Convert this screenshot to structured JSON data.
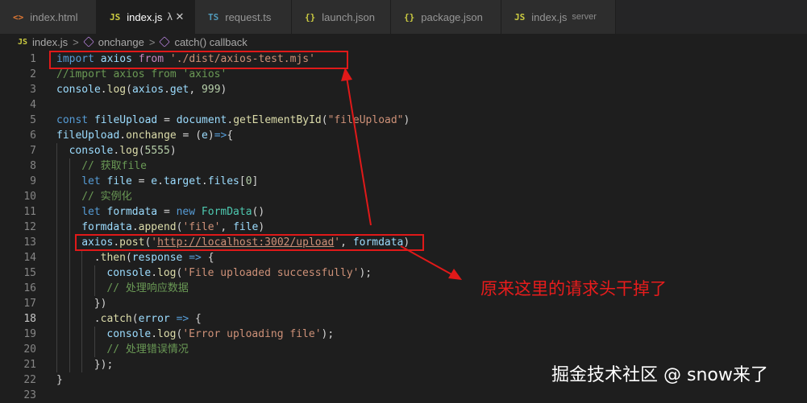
{
  "tabs": [
    {
      "icon": "<>",
      "icon_class": "ico-html",
      "label": "index.html",
      "desc": "",
      "mark": "",
      "active": false,
      "width": 120
    },
    {
      "icon": "JS",
      "icon_class": "ico-js",
      "label": "index.js",
      "desc": "",
      "mark": "λ ✕",
      "active": true,
      "width": 122
    },
    {
      "icon": "TS",
      "icon_class": "ico-ts",
      "label": "request.ts",
      "desc": "",
      "mark": "",
      "active": false,
      "width": 120
    },
    {
      "icon": "{}",
      "icon_class": "ico-json",
      "label": "launch.json",
      "desc": "",
      "mark": "",
      "active": false,
      "width": 123
    },
    {
      "icon": "{}",
      "icon_class": "ico-json",
      "label": "package.json",
      "desc": "",
      "mark": "",
      "active": false,
      "width": 137
    },
    {
      "icon": "JS",
      "icon_class": "ico-js",
      "label": "index.js",
      "desc": "server",
      "mark": "",
      "active": false,
      "width": 142
    }
  ],
  "breadcrumb": {
    "file": "index.js",
    "sep": ">",
    "item1": "onchange",
    "item2": "catch() callback",
    "file_icon": "JS"
  },
  "lines": [
    {
      "n": "1",
      "indent": 0,
      "tokens": [
        [
          "kw",
          "import"
        ],
        [
          "pn",
          " "
        ],
        [
          "var",
          "axios"
        ],
        [
          "pn",
          " "
        ],
        [
          "ctl",
          "from"
        ],
        [
          "pn",
          " "
        ],
        [
          "str",
          "'./dist/axios-test.mjs'"
        ]
      ]
    },
    {
      "n": "2",
      "indent": 0,
      "tokens": [
        [
          "cmt",
          "//import axios from 'axios'"
        ]
      ]
    },
    {
      "n": "3",
      "indent": 0,
      "tokens": [
        [
          "var",
          "console"
        ],
        [
          "pn",
          "."
        ],
        [
          "fn",
          "log"
        ],
        [
          "pn",
          "("
        ],
        [
          "var",
          "axios"
        ],
        [
          "pn",
          "."
        ],
        [
          "var",
          "get"
        ],
        [
          "pn",
          ", "
        ],
        [
          "num",
          "999"
        ],
        [
          "pn",
          ")"
        ]
      ]
    },
    {
      "n": "4",
      "indent": 0,
      "tokens": []
    },
    {
      "n": "5",
      "indent": 0,
      "tokens": [
        [
          "kw",
          "const"
        ],
        [
          "pn",
          " "
        ],
        [
          "var",
          "fileUpload"
        ],
        [
          "pn",
          " = "
        ],
        [
          "var",
          "document"
        ],
        [
          "pn",
          "."
        ],
        [
          "fn",
          "getElementById"
        ],
        [
          "pn",
          "("
        ],
        [
          "str",
          "\"fileUpload\""
        ],
        [
          "pn",
          ")"
        ]
      ]
    },
    {
      "n": "6",
      "indent": 0,
      "tokens": [
        [
          "var",
          "fileUpload"
        ],
        [
          "pn",
          "."
        ],
        [
          "fn",
          "onchange"
        ],
        [
          "pn",
          " = ("
        ],
        [
          "var",
          "e"
        ],
        [
          "pn",
          ")"
        ],
        [
          "kw",
          "=>"
        ],
        [
          "pn",
          "{"
        ]
      ]
    },
    {
      "n": "7",
      "indent": 1,
      "tokens": [
        [
          "var",
          "console"
        ],
        [
          "pn",
          "."
        ],
        [
          "fn",
          "log"
        ],
        [
          "pn",
          "("
        ],
        [
          "num",
          "5555"
        ],
        [
          "pn",
          ")"
        ]
      ]
    },
    {
      "n": "8",
      "indent": 2,
      "tokens": [
        [
          "cmt",
          "// 获取file"
        ]
      ]
    },
    {
      "n": "9",
      "indent": 2,
      "tokens": [
        [
          "kw",
          "let"
        ],
        [
          "pn",
          " "
        ],
        [
          "var",
          "file"
        ],
        [
          "pn",
          " = "
        ],
        [
          "var",
          "e"
        ],
        [
          "pn",
          "."
        ],
        [
          "var",
          "target"
        ],
        [
          "pn",
          "."
        ],
        [
          "var",
          "files"
        ],
        [
          "pn",
          "["
        ],
        [
          "num",
          "0"
        ],
        [
          "pn",
          "]"
        ]
      ]
    },
    {
      "n": "10",
      "indent": 2,
      "tokens": [
        [
          "cmt",
          "// 实例化"
        ]
      ]
    },
    {
      "n": "11",
      "indent": 2,
      "tokens": [
        [
          "kw",
          "let"
        ],
        [
          "pn",
          " "
        ],
        [
          "var",
          "formdata"
        ],
        [
          "pn",
          " = "
        ],
        [
          "kw",
          "new"
        ],
        [
          "pn",
          " "
        ],
        [
          "cls",
          "FormData"
        ],
        [
          "pn",
          "()"
        ]
      ]
    },
    {
      "n": "12",
      "indent": 2,
      "tokens": [
        [
          "var",
          "formdata"
        ],
        [
          "pn",
          "."
        ],
        [
          "fn",
          "append"
        ],
        [
          "pn",
          "("
        ],
        [
          "str",
          "'file'"
        ],
        [
          "pn",
          ", "
        ],
        [
          "var",
          "file"
        ],
        [
          "pn",
          ")"
        ]
      ]
    },
    {
      "n": "13",
      "indent": 2,
      "tokens": [
        [
          "var",
          "axios"
        ],
        [
          "pn",
          "."
        ],
        [
          "fn",
          "post"
        ],
        [
          "pn",
          "("
        ],
        [
          "str",
          "'"
        ],
        [
          "url",
          "http://localhost:3002/upload"
        ],
        [
          "str",
          "'"
        ],
        [
          "pn",
          ", "
        ],
        [
          "var",
          "formdata"
        ],
        [
          "pn",
          ")"
        ]
      ]
    },
    {
      "n": "14",
      "indent": 3,
      "tokens": [
        [
          "pn",
          "."
        ],
        [
          "fn",
          "then"
        ],
        [
          "pn",
          "("
        ],
        [
          "var",
          "response"
        ],
        [
          "pn",
          " "
        ],
        [
          "kw",
          "=>"
        ],
        [
          "pn",
          " {"
        ]
      ]
    },
    {
      "n": "15",
      "indent": 4,
      "tokens": [
        [
          "var",
          "console"
        ],
        [
          "pn",
          "."
        ],
        [
          "fn",
          "log"
        ],
        [
          "pn",
          "("
        ],
        [
          "str",
          "'File uploaded successfully'"
        ],
        [
          "pn",
          ");"
        ]
      ]
    },
    {
      "n": "16",
      "indent": 4,
      "tokens": [
        [
          "cmt",
          "// 处理响应数据"
        ]
      ]
    },
    {
      "n": "17",
      "indent": 3,
      "tokens": [
        [
          "pn",
          "})"
        ]
      ]
    },
    {
      "n": "18",
      "indent": 3,
      "tokens": [
        [
          "pn",
          "."
        ],
        [
          "fn",
          "catch"
        ],
        [
          "pn",
          "("
        ],
        [
          "var",
          "error"
        ],
        [
          "pn",
          " "
        ],
        [
          "kw",
          "=>"
        ],
        [
          "pn",
          " {"
        ]
      ]
    },
    {
      "n": "19",
      "indent": 4,
      "tokens": [
        [
          "var",
          "console"
        ],
        [
          "pn",
          "."
        ],
        [
          "fn",
          "log"
        ],
        [
          "pn",
          "("
        ],
        [
          "str",
          "'Error uploading file'"
        ],
        [
          "pn",
          ");"
        ]
      ]
    },
    {
      "n": "20",
      "indent": 4,
      "tokens": [
        [
          "cmt",
          "// 处理错误情况"
        ]
      ]
    },
    {
      "n": "21",
      "indent": 3,
      "tokens": [
        [
          "pn",
          "});"
        ]
      ]
    },
    {
      "n": "22",
      "indent": 0,
      "tokens": [
        [
          "pn",
          "}"
        ]
      ]
    },
    {
      "n": "23",
      "indent": 0,
      "tokens": []
    }
  ],
  "current_line": "18",
  "annotation": {
    "text": "原来这里的请求头干掉了",
    "color": "#e01919"
  },
  "watermark": {
    "text": "掘金技术社区 @ snow来了"
  },
  "colors": {
    "editor_bg": "#1e1e1e",
    "tab_bg": "#2d2d2d",
    "active_tab_bg": "#1e1e1e",
    "annotation_red": "#e01919"
  }
}
